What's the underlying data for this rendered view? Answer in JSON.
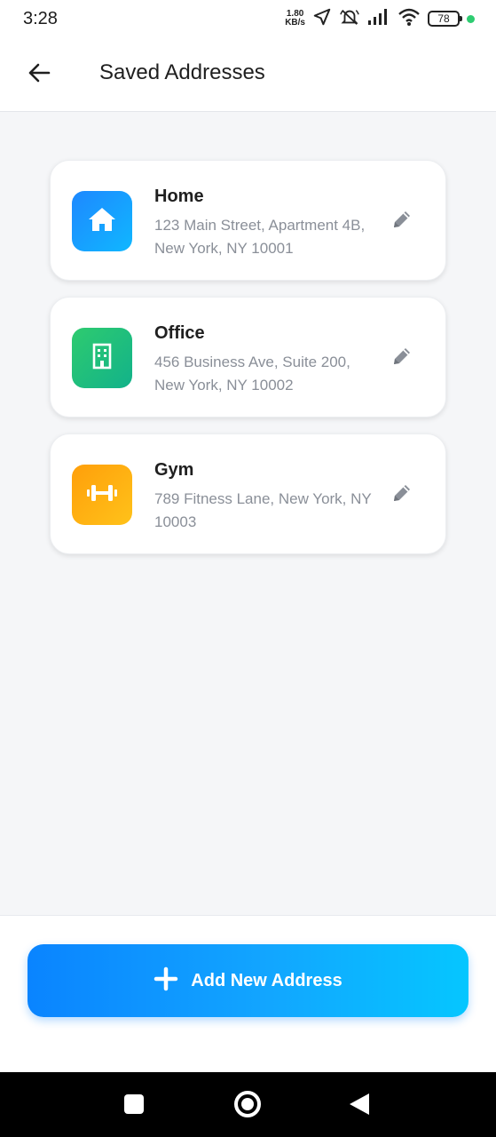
{
  "status_bar": {
    "time": "3:28",
    "net_speed_value": "1.80",
    "net_speed_unit": "KB/s",
    "battery": "78",
    "icons": [
      "navigation-arrow-icon",
      "muted-icon",
      "signal-icon",
      "wifi-icon",
      "battery-icon",
      "notification-dot"
    ]
  },
  "header": {
    "back_icon": "arrow-left-icon",
    "title": "Saved Addresses"
  },
  "addresses": [
    {
      "name": "Home",
      "address": "123 Main Street, Apartment 4B, New York, NY 10001",
      "icon": "house-icon",
      "color_from": "#1e88ff",
      "color_to": "#10b7ff"
    },
    {
      "name": "Office",
      "address": "456 Business Ave, Suite 200, New York, NY 10002",
      "icon": "building-icon",
      "color_from": "#2ecb6f",
      "color_to": "#12b28a"
    },
    {
      "name": "Gym",
      "address": "789 Fitness Lane, New York, NY 10003",
      "icon": "dumbbell-icon",
      "color_from": "#ff9f0a",
      "color_to": "#ffc21a"
    }
  ],
  "edit_icon": "pencil-icon",
  "add_button": {
    "label": "Add New Address",
    "icon": "plus-icon",
    "color_from": "#0a84ff",
    "color_to": "#05c6ff"
  },
  "system_nav": [
    "recent-apps-button",
    "home-button",
    "back-button"
  ]
}
